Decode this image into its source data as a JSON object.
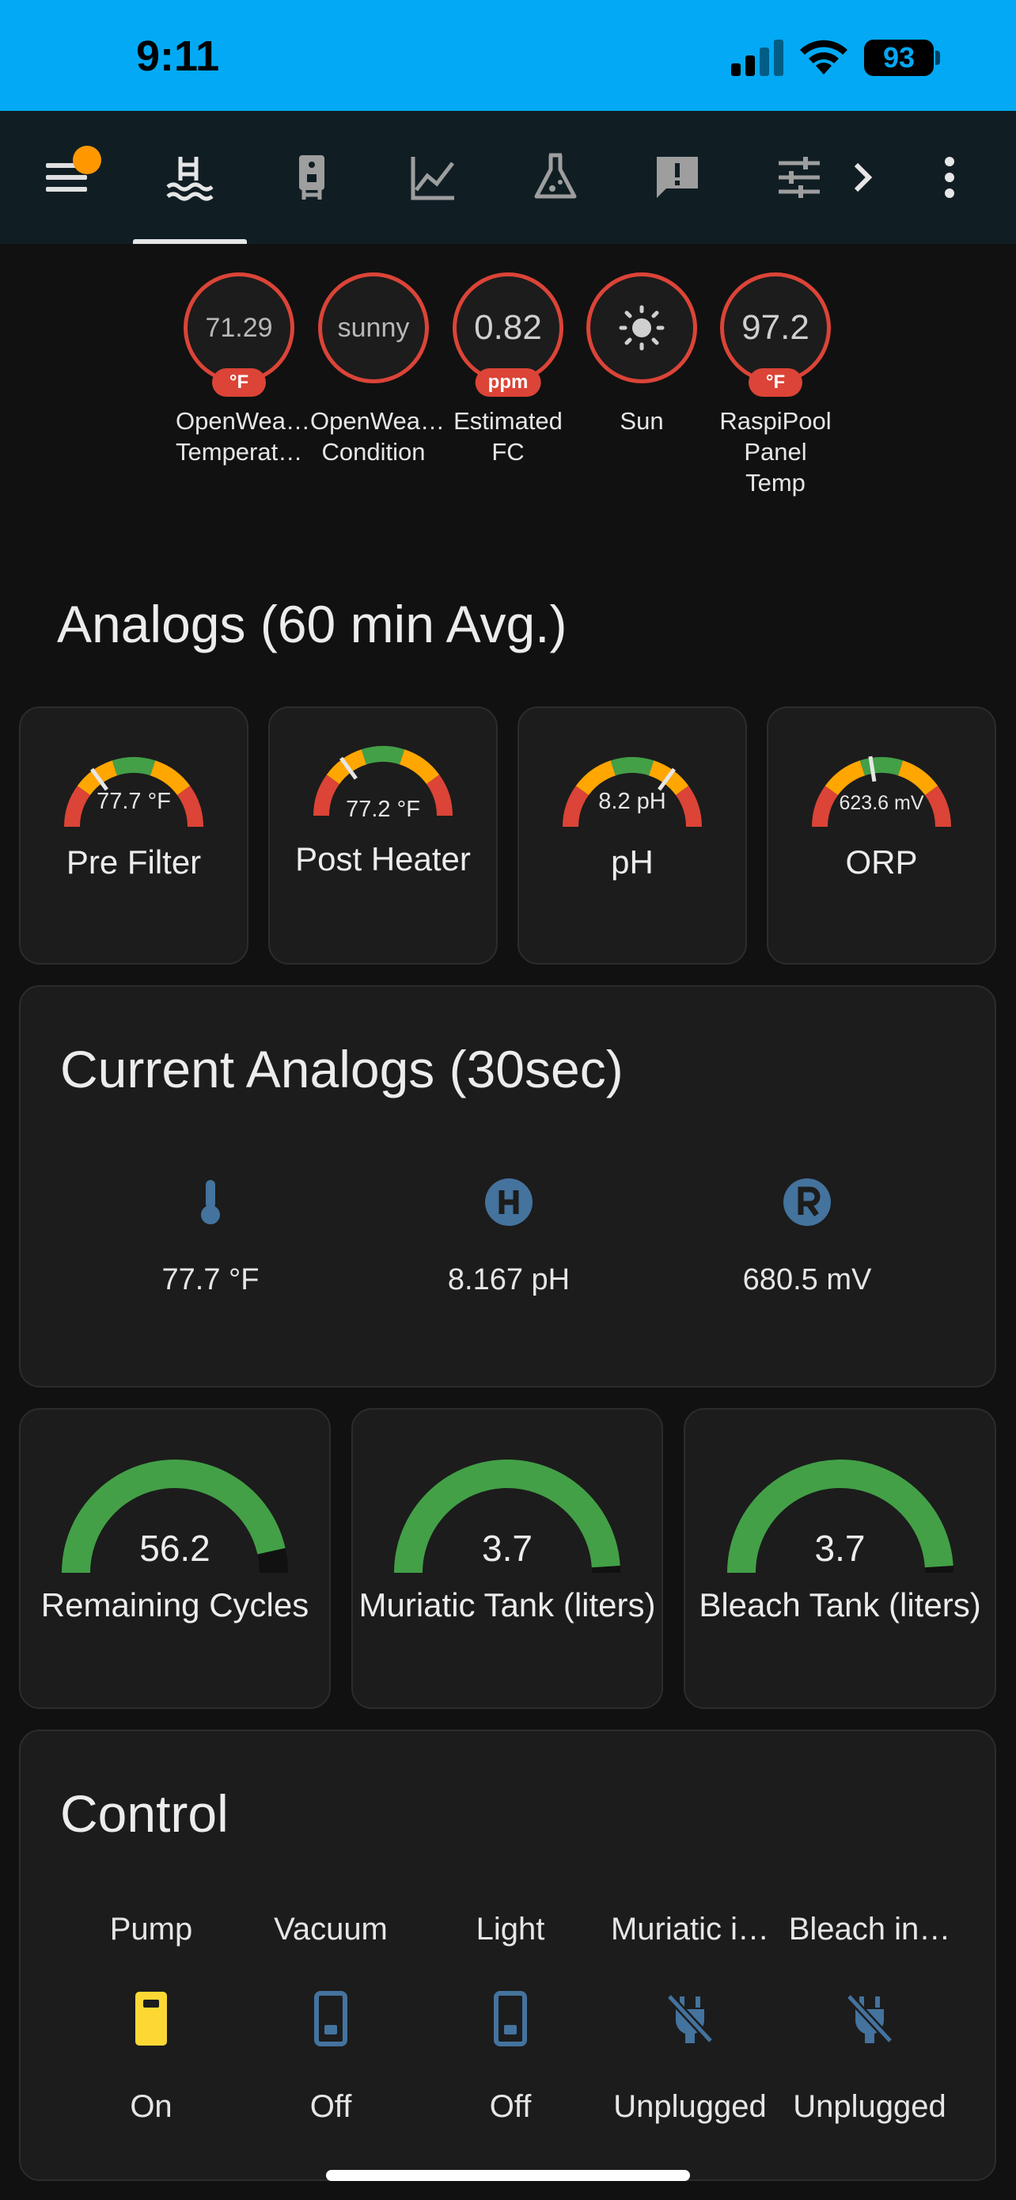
{
  "status_bar": {
    "time": "9:11",
    "battery": "93"
  },
  "colors": {
    "accent": "#03a9f4",
    "toolbar": "#101e24",
    "red": "#db4437",
    "green": "#43a047",
    "orange": "#ff9800",
    "yellow": "#fdd835",
    "blue": "#44739e"
  },
  "toolbar": {
    "icons": [
      "menu-icon",
      "pool-icon",
      "water-heater-icon",
      "chart-line-icon",
      "flask-icon",
      "alert-message-icon",
      "tune-icon",
      "chevron-right-icon",
      "more-vert-icon"
    ]
  },
  "badges": [
    {
      "value": "71.29",
      "unit": "°F",
      "label": "OpenWea…\nTemperat…"
    },
    {
      "value": "sunny",
      "unit": "",
      "label": "OpenWea…\nCondition"
    },
    {
      "value": "0.82",
      "unit": "ppm",
      "label": "Estimated\nFC"
    },
    {
      "value": "",
      "unit": "",
      "icon": "sun-icon",
      "label": "Sun"
    },
    {
      "value": "97.2",
      "unit": "°F",
      "label": "RaspiPool\nPanel\nTemp"
    }
  ],
  "analogs": {
    "title": "Analogs (60 min Avg.)",
    "gauges": [
      {
        "name": "Pre Filter",
        "value": "77.7 °F",
        "needle": 0.3
      },
      {
        "name": "Post\nHeater",
        "value": "77.2 °F",
        "needle": 0.3
      },
      {
        "name": "pH",
        "value": "8.2 pH",
        "needle": 0.7
      },
      {
        "name": "ORP",
        "value": "623.6 mV",
        "needle": 0.45
      }
    ]
  },
  "current": {
    "title": "Current Analogs (30sec)",
    "items": [
      {
        "icon": "thermometer-icon",
        "value": "77.7 °F"
      },
      {
        "icon": "alpha-h-circle-icon",
        "value": "8.167 pH"
      },
      {
        "icon": "alpha-r-circle-icon",
        "value": "680.5 mV"
      }
    ]
  },
  "tanks": [
    {
      "value": "56.2",
      "name": "Remaining\nCycles",
      "fraction": 0.93
    },
    {
      "value": "3.7",
      "name": "Muriatic Tank\n(liters)",
      "fraction": 0.98
    },
    {
      "value": "3.7",
      "name": "Bleach Tank\n(liters)",
      "fraction": 0.98
    }
  ],
  "control": {
    "title": "Control",
    "items": [
      {
        "name": "Pump",
        "state": "On",
        "icon": "switch-on-icon"
      },
      {
        "name": "Vacuum",
        "state": "Off",
        "icon": "switch-off-icon"
      },
      {
        "name": "Light",
        "state": "Off",
        "icon": "switch-off-icon"
      },
      {
        "name": "Muriatic i…",
        "state": "Unplugged",
        "icon": "power-plug-off-icon"
      },
      {
        "name": "Bleach in…",
        "state": "Unplugged",
        "icon": "power-plug-off-icon"
      }
    ]
  }
}
